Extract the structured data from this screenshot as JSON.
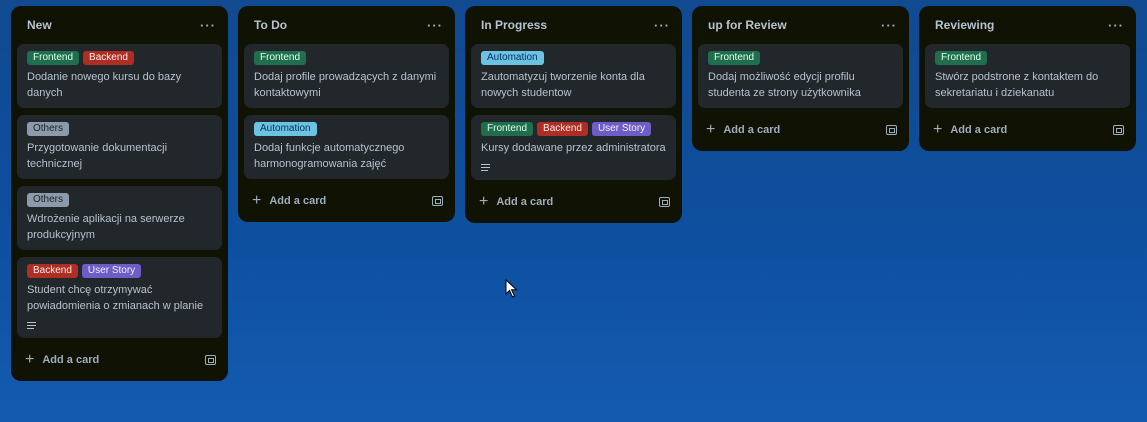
{
  "lists": [
    {
      "title": "New",
      "menu": "···",
      "cards": [
        {
          "labels": [
            {
              "text": "Frontend",
              "kind": "frontend"
            },
            {
              "text": "Backend",
              "kind": "backend"
            }
          ],
          "text": "Dodanie nowego kursu do bazy danych",
          "has_description": false
        },
        {
          "labels": [
            {
              "text": "Others",
              "kind": "others"
            }
          ],
          "text": "Przygotowanie dokumentacji technicznej",
          "has_description": false
        },
        {
          "labels": [
            {
              "text": "Others",
              "kind": "others"
            }
          ],
          "text": "Wdrożenie aplikacji na serwerze produkcyjnym",
          "has_description": false
        },
        {
          "labels": [
            {
              "text": "Backend",
              "kind": "backend"
            },
            {
              "text": "User Story",
              "kind": "userstory"
            }
          ],
          "text": "Student chcę otrzymywać powiadomienia o zmianach w planie",
          "has_description": true
        }
      ],
      "add_label": "Add a card"
    },
    {
      "title": "To Do",
      "menu": "···",
      "cards": [
        {
          "labels": [
            {
              "text": "Frontend",
              "kind": "frontend"
            }
          ],
          "text": "Dodaj profile prowadzących z danymi kontaktowymi",
          "has_description": false
        },
        {
          "labels": [
            {
              "text": "Automation",
              "kind": "automation"
            }
          ],
          "text": "Dodaj funkcje automatycznego harmonogramowania zajęć",
          "has_description": false
        }
      ],
      "add_label": "Add a card"
    },
    {
      "title": "In Progress",
      "menu": "···",
      "cards": [
        {
          "labels": [
            {
              "text": "Automation",
              "kind": "automation"
            }
          ],
          "text": "Zautomatyzuj tworzenie konta dla nowych studentow",
          "has_description": false
        },
        {
          "labels": [
            {
              "text": "Frontend",
              "kind": "frontend"
            },
            {
              "text": "Backend",
              "kind": "backend"
            },
            {
              "text": "User Story",
              "kind": "userstory"
            }
          ],
          "text": "Kursy dodawane przez administratora",
          "has_description": true
        }
      ],
      "add_label": "Add a card"
    },
    {
      "title": "up for Review",
      "menu": "···",
      "cards": [
        {
          "labels": [
            {
              "text": "Frontend",
              "kind": "frontend"
            }
          ],
          "text": "Dodaj możliwość edycji profilu studenta ze strony użytkownika",
          "has_description": false
        }
      ],
      "add_label": "Add a card"
    },
    {
      "title": "Reviewing",
      "menu": "···",
      "cards": [
        {
          "labels": [
            {
              "text": "Frontend",
              "kind": "frontend"
            }
          ],
          "text": "Stwórz podstrone z kontaktem do sekretariatu i dziekanatu",
          "has_description": false
        }
      ],
      "add_label": "Add a card"
    }
  ],
  "icons": {
    "add": "plus-icon",
    "template": "card-template-icon",
    "description": "description-icon",
    "cursor": "mouse-pointer-icon"
  },
  "colors": {
    "list_bg": "#101204",
    "card_bg": "#22272b",
    "frontend": "#216e4e",
    "backend": "#ae2e24",
    "others": "#8c9bab",
    "automation": "#6cc3e0",
    "userstory": "#6e5dc6"
  }
}
